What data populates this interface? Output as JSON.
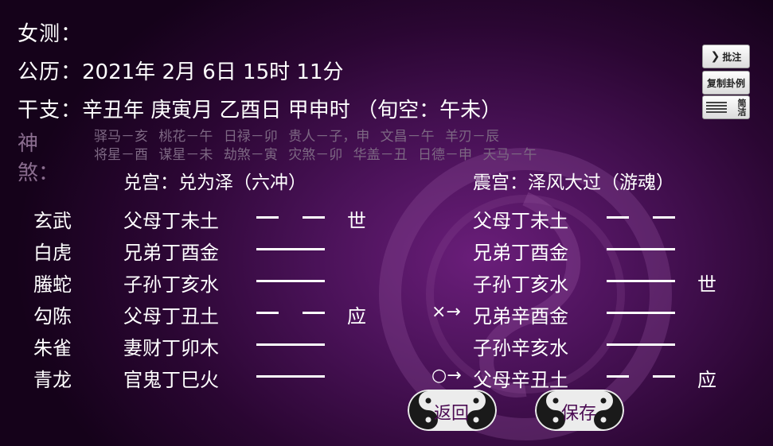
{
  "header": {
    "female_label": "女测：",
    "solar_label": "公历：",
    "solar_value": "2021年 2月 6日 15时 11分",
    "ganzhi_label": "干支：",
    "ganzhi_value": "辛丑年 庚寅月 乙酉日 甲申时 （旬空：午未）"
  },
  "shensha": {
    "label": "神煞：",
    "row1": [
      "驿马－亥",
      "桃花－午",
      "日禄－卯",
      "贵人－子，申",
      "文昌－午",
      "羊刃－辰"
    ],
    "row2": [
      "将星－酉",
      "谋星－未",
      "劫煞－寅",
      "灾煞－卯",
      "华盖－丑",
      "日德－申",
      "天马－午"
    ]
  },
  "main_gua": {
    "title": "兑宫：兑为泽（六冲）"
  },
  "changed_gua": {
    "title": "震宫：泽风大过（游魂）"
  },
  "six_spirits": [
    "玄武",
    "白虎",
    "螣蛇",
    "勾陈",
    "朱雀",
    "青龙"
  ],
  "main_lines": [
    {
      "text": "父母丁未土",
      "type": "yin",
      "mark": "世"
    },
    {
      "text": "兄弟丁酉金",
      "type": "yang",
      "mark": ""
    },
    {
      "text": "子孙丁亥水",
      "type": "yang",
      "mark": ""
    },
    {
      "text": "父母丁丑土",
      "type": "yin",
      "mark": "应"
    },
    {
      "text": "妻财丁卯木",
      "type": "yang",
      "mark": ""
    },
    {
      "text": "官鬼丁巳火",
      "type": "yang",
      "mark": ""
    }
  ],
  "moving_symbols": [
    "",
    "",
    "",
    "×→",
    "",
    "○→"
  ],
  "changed_lines": [
    {
      "text": "父母丁未土",
      "type": "yin",
      "mark": ""
    },
    {
      "text": "兄弟丁酉金",
      "type": "yang",
      "mark": ""
    },
    {
      "text": "子孙丁亥水",
      "type": "yang",
      "mark": "世"
    },
    {
      "text": "兄弟辛酉金",
      "type": "yang",
      "mark": ""
    },
    {
      "text": "子孙辛亥水",
      "type": "yang",
      "mark": ""
    },
    {
      "text": "父母辛丑土",
      "type": "yin",
      "mark": "应"
    }
  ],
  "side_buttons": {
    "annotate": "批注",
    "copy": "复制卦例",
    "simple": "简洁"
  },
  "bottom_buttons": {
    "back": "返回",
    "save": "保存"
  }
}
